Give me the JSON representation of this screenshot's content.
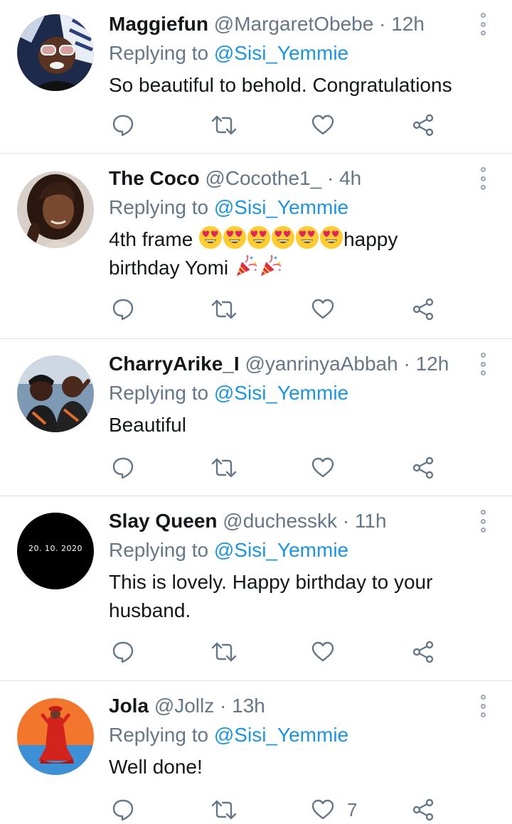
{
  "colors": {
    "link": "#1b95e0",
    "secondary": "#657786",
    "text": "#14171a",
    "separator": "#dfe3e7"
  },
  "tweets": [
    {
      "name": "Maggiefun",
      "handle": "@MargaretObebe",
      "dot": "·",
      "time": "12h",
      "reply_prefix": "Replying to",
      "reply_to": "@Sisi_Yemmie",
      "text_1": "So beautiful to behold. Congratulations",
      "text_2": "",
      "like_count": ""
    },
    {
      "name": "The Coco",
      "handle": "@Cocothe1_",
      "dot": "·",
      "time": "4h",
      "reply_prefix": "Replying to",
      "reply_to": "@Sisi_Yemmie",
      "text_1": "4th frame",
      "text_1_after": "happy",
      "text_2": "birthday Yomi",
      "emoji_line_1": [
        "heart-eyes-emoji",
        "heart-eyes-emoji",
        "heart-eyes-emoji",
        "heart-eyes-emoji",
        "heart-eyes-emoji",
        "heart-eyes-emoji"
      ],
      "emoji_line_2": [
        "party-popper-emoji",
        "party-popper-emoji"
      ],
      "like_count": ""
    },
    {
      "name": "CharryArike_I",
      "handle": "@yanrinyaAbbah",
      "dot": "·",
      "time": "12h",
      "reply_prefix": "Replying to",
      "reply_to": "@Sisi_Yemmie",
      "text_1": "Beautiful",
      "text_2": "",
      "like_count": ""
    },
    {
      "name": "Slay Queen",
      "handle": "@duchesskk",
      "dot": "·",
      "time": "11h",
      "reply_prefix": "Replying to",
      "reply_to": "@Sisi_Yemmie",
      "text_1": "This is lovely. Happy birthday to your",
      "text_2": "husband.",
      "avatar_text": "20. 10. 2020",
      "like_count": ""
    },
    {
      "name": "Jola",
      "handle": "@Jollz",
      "dot": "·",
      "time": "13h",
      "reply_prefix": "Replying to",
      "reply_to": "@Sisi_Yemmie",
      "text_1": "Well done!",
      "text_2": "",
      "like_count": "7"
    }
  ],
  "icons": {
    "reply": "reply-icon",
    "retweet": "retweet-icon",
    "like": "heart-icon",
    "share": "share-icon",
    "more": "more-options-icon"
  }
}
